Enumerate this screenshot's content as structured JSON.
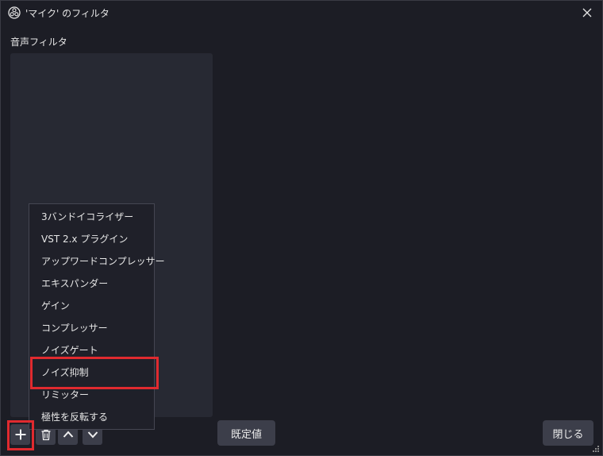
{
  "window": {
    "title": "'マイク' のフィルタ"
  },
  "section_label": "音声フィルタ",
  "add_filter_menu": {
    "items": [
      "3バンドイコライザー",
      "VST 2.x プラグイン",
      "アップワードコンプレッサー",
      "エキスパンダー",
      "ゲイン",
      "コンプレッサー",
      "ノイズゲート",
      "ノイズ抑制",
      "リミッター",
      "極性を反転する"
    ],
    "highlighted_item": "ノイズ抑制"
  },
  "toolbar": {
    "add_icon": "plus-icon",
    "remove_icon": "trash-icon",
    "move_up_icon": "chevron-up-icon",
    "move_down_icon": "chevron-down-icon"
  },
  "buttons": {
    "defaults_label": "既定値",
    "close_label": "閉じる"
  },
  "colors": {
    "background": "#1c1d25",
    "list_panel": "#272933",
    "button": "#3c3e4a",
    "highlight_box": "#e02a2f"
  }
}
